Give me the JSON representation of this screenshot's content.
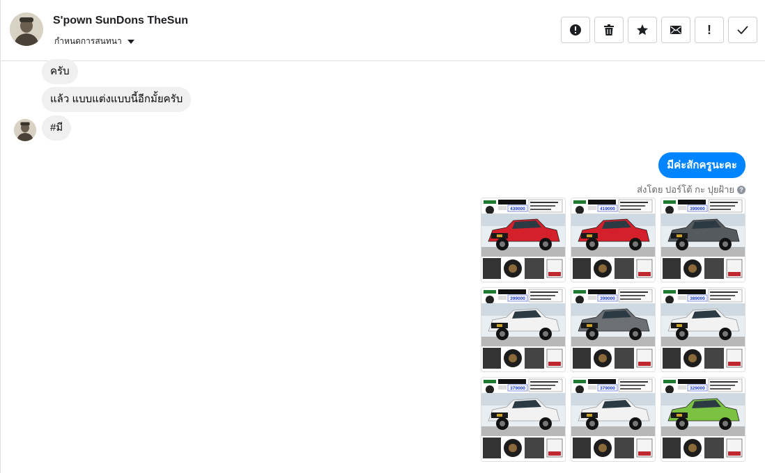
{
  "header": {
    "contact_name": "S'pown SunDons TheSun",
    "assign_label": "กำหนดการสนทนา",
    "toolbar": [
      {
        "name": "spam-button",
        "icon": "alert-circle-icon"
      },
      {
        "name": "delete-button",
        "icon": "trash-icon"
      },
      {
        "name": "star-button",
        "icon": "star-icon"
      },
      {
        "name": "mark-unread-button",
        "icon": "envelope-icon"
      },
      {
        "name": "follow-up-button",
        "icon": "exclamation-icon",
        "label": "!"
      },
      {
        "name": "mark-done-button",
        "icon": "check-icon"
      }
    ]
  },
  "messages": {
    "incoming": [
      "ครับ",
      "แล้ว แบบแต่งแบบนี้อีกมั้ยครับ",
      "#มี"
    ],
    "outgoing": "มีค่ะสักครูนะคะ",
    "sent_by": "ส่งโดย ปอร์โต้ กะ ปุยฝ้าย",
    "help_glyph": "?"
  },
  "attachments": [
    {
      "name": "truck-photo-1",
      "car_color": "#d3202a",
      "price": "439000"
    },
    {
      "name": "truck-photo-2",
      "car_color": "#d3202a",
      "price": "419000"
    },
    {
      "name": "truck-photo-3",
      "car_color": "#555a5e",
      "price": "399000"
    },
    {
      "name": "truck-photo-4",
      "car_color": "#f2f2f2",
      "price": "399000"
    },
    {
      "name": "truck-photo-5",
      "car_color": "#6c7074",
      "price": "399000"
    },
    {
      "name": "truck-photo-6",
      "car_color": "#f2f2f2",
      "price": "389000"
    },
    {
      "name": "truck-photo-7",
      "car_color": "#f2f2f2",
      "price": "379000"
    },
    {
      "name": "truck-photo-8",
      "car_color": "#f2f2f2",
      "price": "379000"
    },
    {
      "name": "truck-photo-9",
      "car_color": "#7cc242",
      "price": "329000"
    }
  ],
  "colors": {
    "accent": "#0084ff",
    "incoming_bubble": "#f0f0f0",
    "sent_by_text": "#65676b"
  }
}
